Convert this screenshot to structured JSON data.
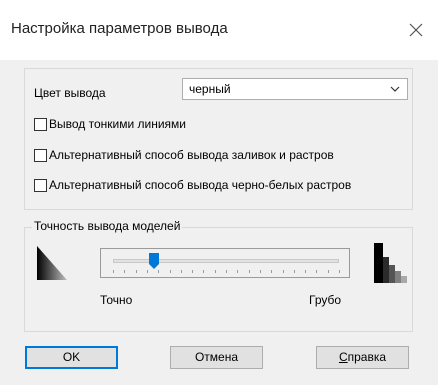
{
  "window": {
    "title": "Настройка параметров вывода"
  },
  "output_color": {
    "label": "Цвет вывода",
    "selected": "черный"
  },
  "options": [
    {
      "label": "Вывод тонкими линиями",
      "checked": false
    },
    {
      "label": "Альтернативный способ вывода заливок и растров",
      "checked": false
    },
    {
      "label": "Альтернативный способ вывода черно-белых растров",
      "checked": false
    }
  ],
  "precision": {
    "group_title": "Точность вывода моделей",
    "label_min": "Точно",
    "label_max": "Грубо",
    "slider_value_fraction": 0.18
  },
  "buttons": {
    "ok": "OK",
    "cancel": "Отмена",
    "help_mnemonic": "С",
    "help_rest": "правка"
  },
  "colors": {
    "accent": "#0078d7",
    "background": "#f0f0f0",
    "slider_thumb": "#0078d7"
  }
}
